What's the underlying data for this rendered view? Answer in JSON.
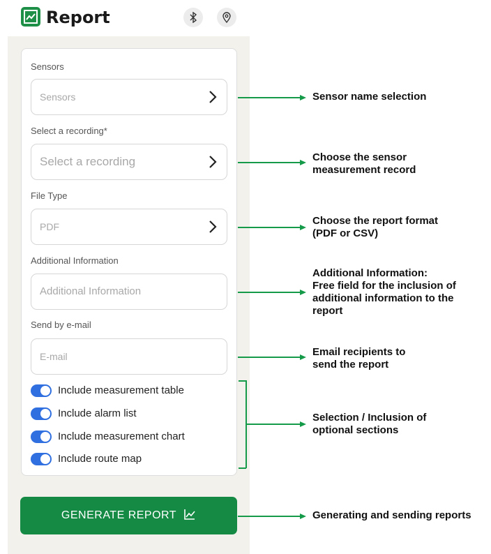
{
  "header": {
    "title": "Report",
    "logo_icon": "chart-line-icon",
    "bluetooth_icon": "bluetooth-icon",
    "location_icon": "location-pin-icon"
  },
  "form": {
    "sensors": {
      "label": "Sensors",
      "placeholder": "Sensors"
    },
    "recording": {
      "label": "Select a recording*",
      "placeholder": "Select a recording"
    },
    "file_type": {
      "label": "File Type",
      "placeholder": "PDF"
    },
    "additional": {
      "label": "Additional Information",
      "placeholder": "Additional Information"
    },
    "email": {
      "label": "Send by e-mail",
      "placeholder": "E-mail"
    },
    "toggles": [
      {
        "label": "Include measurement table",
        "on": true
      },
      {
        "label": "Include alarm list",
        "on": true
      },
      {
        "label": "Include measurement chart",
        "on": true
      },
      {
        "label": "Include route map",
        "on": true
      }
    ]
  },
  "generate_button": {
    "label": "GENERATE REPORT"
  },
  "annotations": [
    [
      "Sensor name selection"
    ],
    [
      "Choose the sensor",
      "measurement record"
    ],
    [
      "Choose the report format",
      "(PDF or CSV)"
    ],
    [
      "Additional Information:",
      "Free field for the inclusion of",
      "additional information to the",
      "report"
    ],
    [
      "Email recipients to",
      "send the report"
    ],
    [
      "Selection / Inclusion of",
      "optional sections"
    ],
    [
      "Generating and sending reports"
    ]
  ],
  "colors": {
    "brand_green": "#148a44",
    "toggle_blue": "#2f6fe0",
    "arrow_green": "#149a48"
  }
}
